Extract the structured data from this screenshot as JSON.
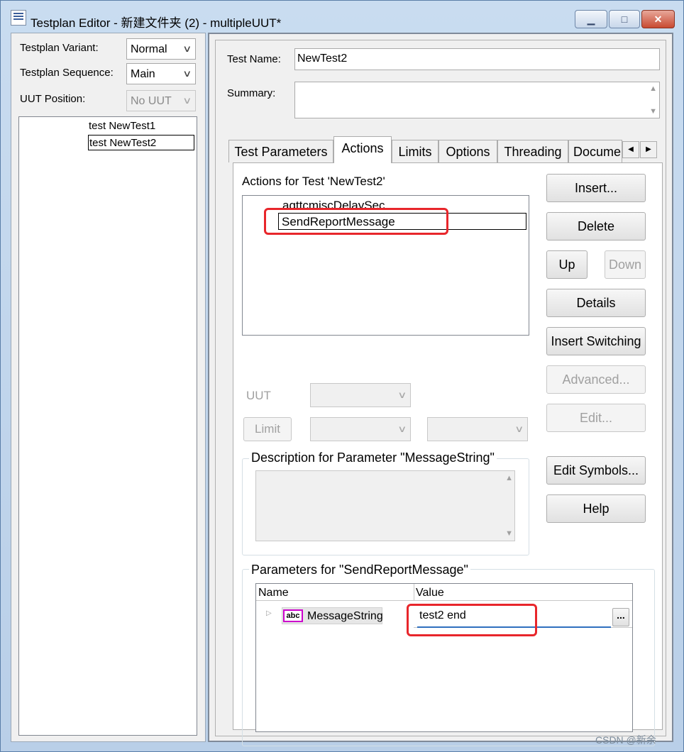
{
  "window": {
    "title": "Testplan Editor - 新建文件夹 (2) - multipleUUT*",
    "min_glyph": "▁",
    "max_glyph": "□",
    "close_glyph": "✕"
  },
  "left": {
    "variant_label": "Testplan Variant:",
    "variant_value": "Normal",
    "sequence_label": "Testplan Sequence:",
    "sequence_value": "Main",
    "uut_label": "UUT Position:",
    "uut_value": "No UUT",
    "tests": [
      "test NewTest1",
      "test NewTest2"
    ]
  },
  "right": {
    "test_name_label": "Test Name:",
    "test_name_value": "NewTest2",
    "summary_label": "Summary:",
    "tabs": [
      "Test Parameters",
      "Actions",
      "Limits",
      "Options",
      "Threading",
      "Docume"
    ],
    "actions_heading": "Actions for Test 'NewTest2'",
    "actions_list": [
      "agttcmiscDelaySec",
      "SendReportMessage"
    ],
    "uut_label": "UUT",
    "limit_button": "Limit",
    "buttons": {
      "insert": "Insert...",
      "delete": "Delete",
      "up": "Up",
      "down": "Down",
      "details": "Details",
      "insert_switching": "Insert Switching",
      "advanced": "Advanced...",
      "edit": "Edit...",
      "edit_symbols": "Edit Symbols...",
      "help": "Help"
    },
    "description_title": "Description for Parameter \"MessageString\"",
    "parameters_title": "Parameters for \"SendReportMessage\"",
    "grid": {
      "col_name": "Name",
      "col_value": "Value",
      "row_name": "MessageString",
      "row_type_badge": "abc",
      "row_value": "test2 end",
      "ellipsis": "..."
    }
  },
  "watermark": "CSDN @新余"
}
